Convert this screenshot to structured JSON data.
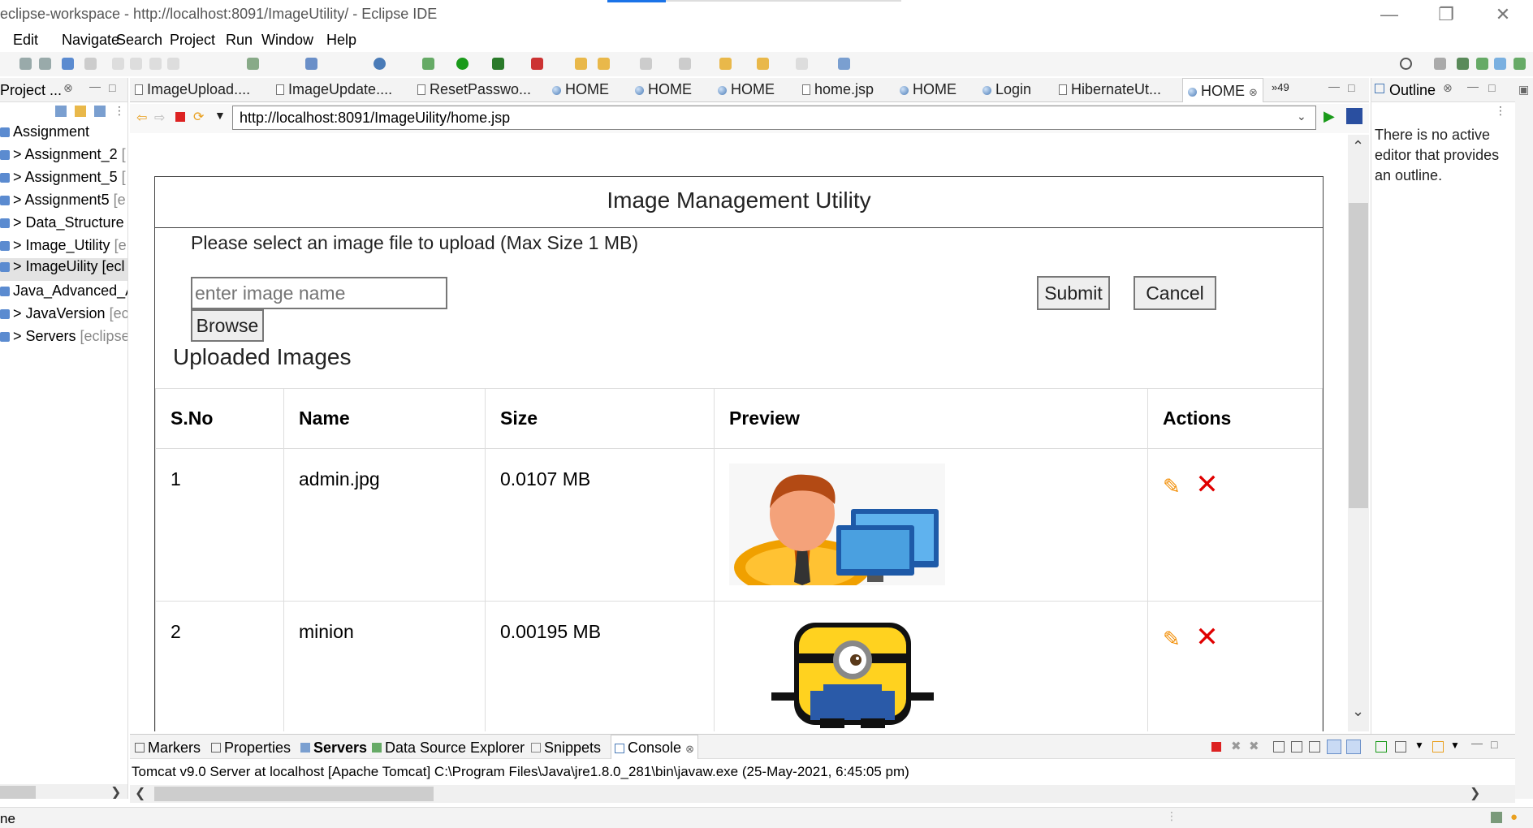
{
  "window": {
    "title": "eclipse-workspace - http://localhost:8091/ImageUtility/ - Eclipse IDE"
  },
  "menu": [
    "Edit",
    "Navigate",
    "Search",
    "Project",
    "Run",
    "Window",
    "Help"
  ],
  "project_explorer": {
    "title": "Project ...",
    "items": [
      {
        "label": "Assignment",
        "suffix": ""
      },
      {
        "label": "> Assignment_2",
        "suffix": "["
      },
      {
        "label": "> Assignment_5",
        "suffix": "["
      },
      {
        "label": "> Assignment5",
        "suffix": "[e"
      },
      {
        "label": "> Data_Structure",
        "suffix": "["
      },
      {
        "label": "> Image_Utility",
        "suffix": "[e"
      },
      {
        "label": "> ImageUility [ecl",
        "suffix": ""
      },
      {
        "label": "Java_Advanced_A",
        "suffix": ""
      },
      {
        "label": "> JavaVersion",
        "suffix": "[ecl"
      },
      {
        "label": "> Servers",
        "suffix": "[eclipse"
      }
    ]
  },
  "editor_tabs": [
    {
      "label": "ImageUpload....",
      "icon": "doc"
    },
    {
      "label": "ImageUpdate....",
      "icon": "doc"
    },
    {
      "label": "ResetPasswo...",
      "icon": "doc"
    },
    {
      "label": "HOME",
      "icon": "globe"
    },
    {
      "label": "HOME",
      "icon": "globe"
    },
    {
      "label": "HOME",
      "icon": "globe"
    },
    {
      "label": "home.jsp",
      "icon": "doc"
    },
    {
      "label": "HOME",
      "icon": "globe"
    },
    {
      "label": "Login",
      "icon": "globe"
    },
    {
      "label": "HibernateUt...",
      "icon": "doc"
    },
    {
      "label": "HOME",
      "icon": "globe",
      "active": true
    }
  ],
  "tabs_overflow": "»49",
  "browser": {
    "url": "http://localhost:8091/ImageUility/home.jsp"
  },
  "page": {
    "heading": "Image Management Utility",
    "instructions": "Please select an image file to upload (Max Size 1 MB)",
    "name_placeholder": "enter image name",
    "browse_label": "Browse",
    "submit_label": "Submit",
    "cancel_label": "Cancel",
    "uploaded_title": "Uploaded Images",
    "table": {
      "headers": [
        "S.No",
        "Name",
        "Size",
        "Preview",
        "Actions"
      ],
      "rows": [
        {
          "sno": "1",
          "name": "admin.jpg",
          "size": "0.0107 MB",
          "preview": "admin-user-computer-icon"
        },
        {
          "sno": "2",
          "name": "minion",
          "size": "0.00195 MB",
          "preview": "pixel-minion-icon"
        }
      ]
    }
  },
  "outline": {
    "title": "Outline",
    "message": "There is no active editor that provides an outline."
  },
  "console": {
    "tabs": [
      "Markers",
      "Properties",
      "Servers",
      "Data Source Explorer",
      "Snippets",
      "Console"
    ],
    "line": "Tomcat v9.0 Server at localhost [Apache Tomcat] C:\\Program Files\\Java\\jre1.8.0_281\\bin\\javaw.exe  (25-May-2021, 6:45:05 pm)"
  },
  "statusbar": {
    "left_text": "ne"
  },
  "colors": {
    "accent": "#1a73e8",
    "delete": "#e00000",
    "edit": "#f28c00"
  }
}
